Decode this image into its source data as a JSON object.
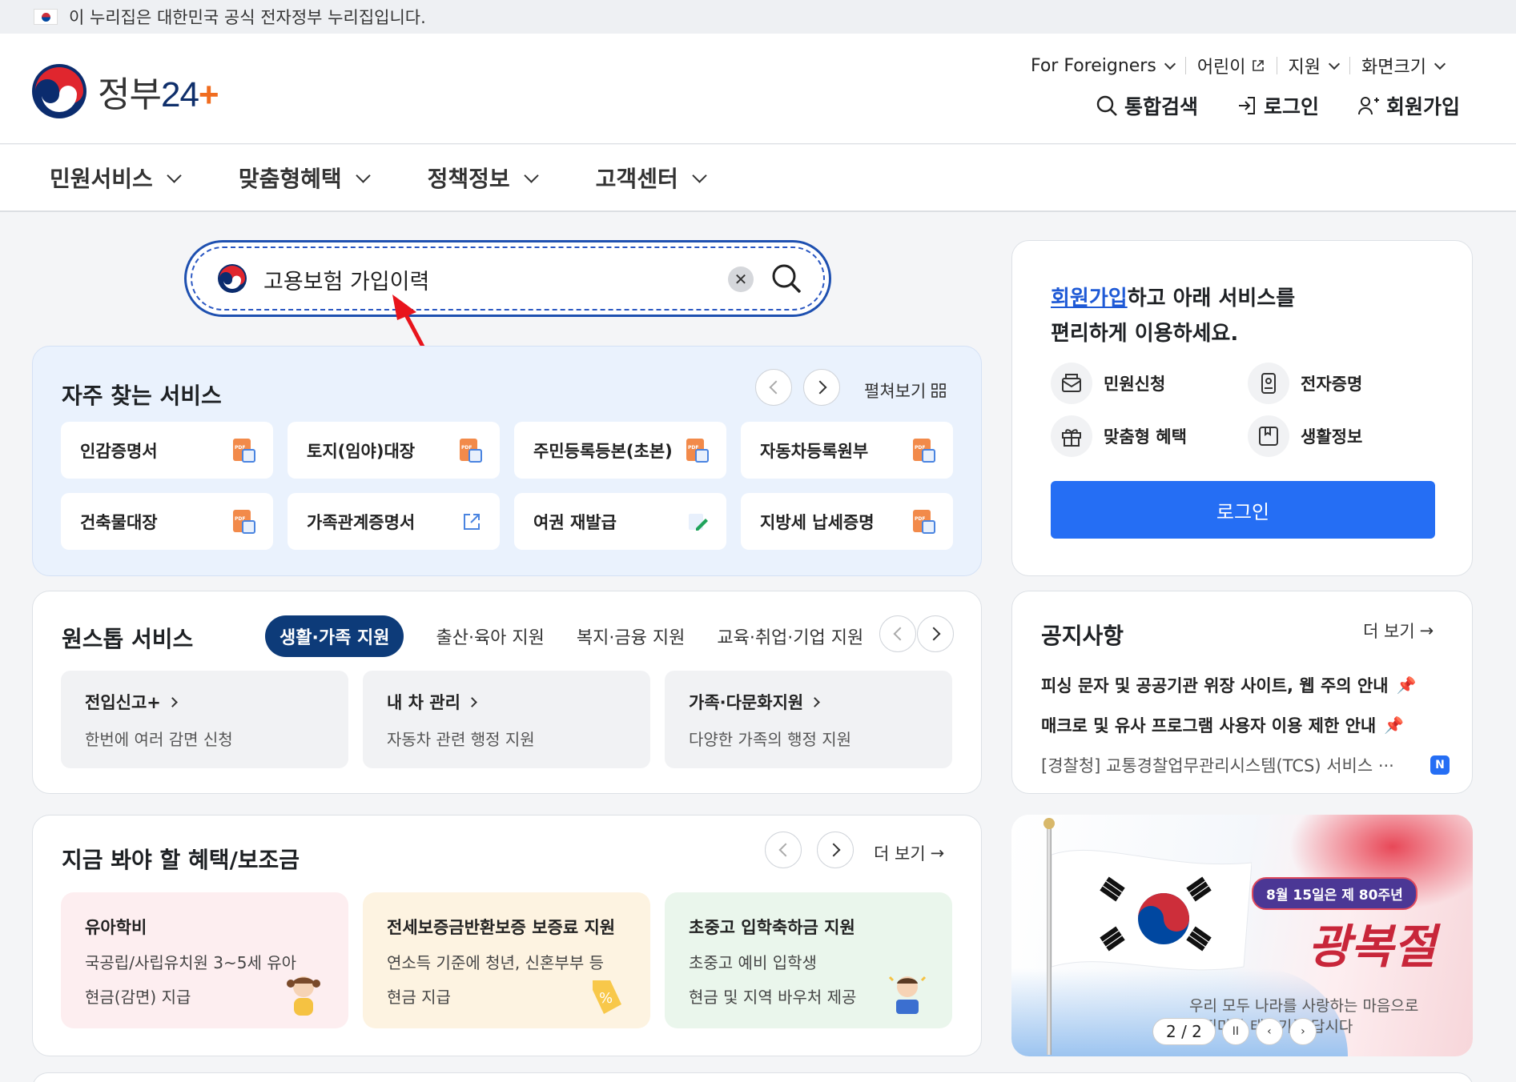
{
  "gov_banner": {
    "text": "이 누리집은 대한민국 공식 전자정부 누리집입니다."
  },
  "logo": {
    "name": "정부",
    "num": "24",
    "plus": "+"
  },
  "utility": {
    "foreigners": "For Foreigners",
    "kids": "어린이",
    "support": "지원",
    "screen_size": "화면크기"
  },
  "actions": {
    "search": "통합검색",
    "login": "로그인",
    "signup": "회원가입"
  },
  "gnb": [
    "민원서비스",
    "맞춤형혜택",
    "정책정보",
    "고객센터"
  ],
  "search": {
    "value": "고용보험 가입이력"
  },
  "frequent": {
    "title": "자주 찾는 서비스",
    "expand": "펼쳐보기",
    "items": [
      "인감증명서",
      "토지(임야)대장",
      "주민등록등본(초본)",
      "자동차등록원부",
      "건축물대장",
      "가족관계증명서",
      "여권 재발급",
      "지방세 납세증명"
    ]
  },
  "onestop": {
    "title": "원스톱 서비스",
    "tabs": [
      "생활·가족 지원",
      "출산·육아 지원",
      "복지·금융 지원",
      "교육·취업·기업 지원"
    ],
    "items": [
      {
        "title": "전입신고+",
        "desc": "한번에 여러 감면 신청"
      },
      {
        "title": "내 차 관리",
        "desc": "자동차 관련 행정 지원"
      },
      {
        "title": "가족·다문화지원",
        "desc": "다양한 가족의 행정 지원"
      }
    ]
  },
  "benefits": {
    "title": "지금 봐야 할 혜택/보조금",
    "more": "더 보기",
    "items": [
      {
        "title": "유아학비",
        "line1": "국공립/사립유치원 3~5세 유아",
        "line2": "현금(감면) 지급",
        "bg": "#fdeef0"
      },
      {
        "title": "전세보증금반환보증 보증료 지원",
        "line1": "연소득 기준에 청년, 신혼부부 등",
        "line2": "현금 지급",
        "bg": "#fdf3e1"
      },
      {
        "title": "초중고 입학축하금 지원",
        "line1": "초중고 예비 입학생",
        "line2": "현금 및 지역 바우처 제공",
        "bg": "#eaf6ec"
      }
    ]
  },
  "login_card": {
    "highlight": "회원가입",
    "msg1": "하고 아래 서비스를",
    "msg2": "편리하게 이용하세요.",
    "quick": [
      "민원신청",
      "전자증명",
      "맞춤형 혜택",
      "생활정보"
    ],
    "button": "로그인"
  },
  "notice": {
    "title": "공지사항",
    "more": "더 보기",
    "items": [
      "피싱 문자 및 공공기관 위장 사이트, 웹 주의 안내",
      "매크로 및 유사 프로그램 사용자 이용 제한 안내",
      "[경찰청] 교통경찰업무관리시스템(TCS) 서비스 ···"
    ],
    "new_badge": "N"
  },
  "banner": {
    "pill": "8월 15일은 제 80주년",
    "big": "광복절",
    "sub1": "우리 모두 나라를 사랑하는 마음으로",
    "sub2": "집집마다 태극기를 답시다",
    "page": "2 / 2"
  }
}
